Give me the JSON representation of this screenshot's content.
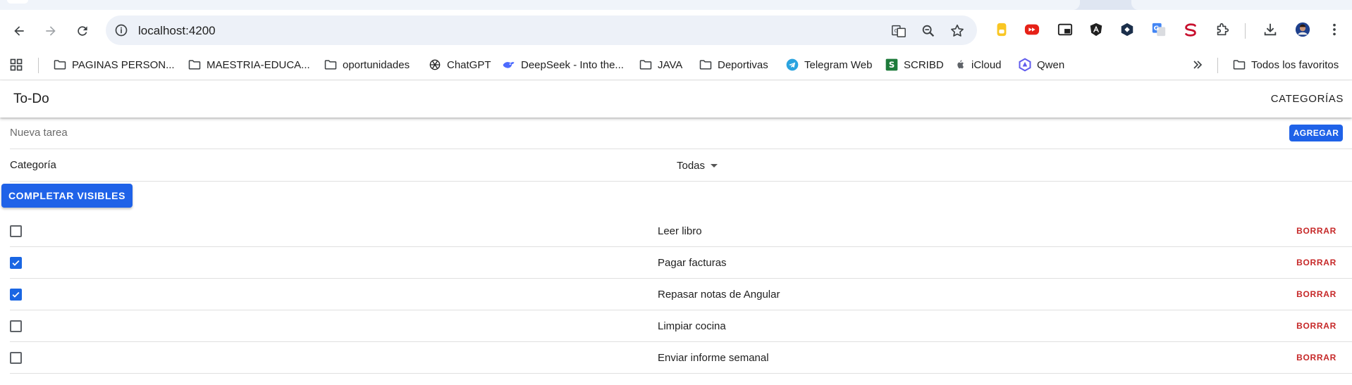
{
  "browser": {
    "url": "localhost:4200",
    "bookmarks": [
      {
        "label": "PAGINAS PERSON...",
        "icon": "folder-icon"
      },
      {
        "label": "MAESTRIA-EDUCA...",
        "icon": "folder-icon"
      },
      {
        "label": "oportunidades",
        "icon": "folder-icon"
      },
      {
        "label": "ChatGPT",
        "icon": "chatgpt-icon"
      },
      {
        "label": "DeepSeek - Into the...",
        "icon": "deepseek-icon"
      },
      {
        "label": "JAVA",
        "icon": "folder-icon"
      },
      {
        "label": "Deportivas",
        "icon": "folder-icon"
      },
      {
        "label": "Telegram Web",
        "icon": "telegram-icon"
      },
      {
        "label": "SCRIBD",
        "icon": "scribd-icon"
      },
      {
        "label": "iCloud",
        "icon": "apple-icon"
      },
      {
        "label": "Qwen",
        "icon": "qwen-icon"
      }
    ],
    "all_bookmarks": "Todos los favoritos"
  },
  "app": {
    "title": "To-Do",
    "categories_link": "CATEGORÍAS",
    "new_task_placeholder": "Nueva tarea",
    "add_button": "AGREGAR",
    "category_label": "Categoría",
    "category_selected": "Todas",
    "complete_visible_button": "COMPLETAR VISIBLES",
    "delete_label": "BORRAR",
    "tasks": [
      {
        "title": "Leer libro",
        "done": false
      },
      {
        "title": "Pagar facturas",
        "done": true
      },
      {
        "title": "Repasar notas de Angular",
        "done": true
      },
      {
        "title": "Limpiar cocina",
        "done": false
      },
      {
        "title": "Enviar informe semanal",
        "done": false
      }
    ]
  },
  "colors": {
    "primary": "#1f62e8",
    "danger": "#c62828",
    "checkbox_checked": "#1a66e3"
  }
}
